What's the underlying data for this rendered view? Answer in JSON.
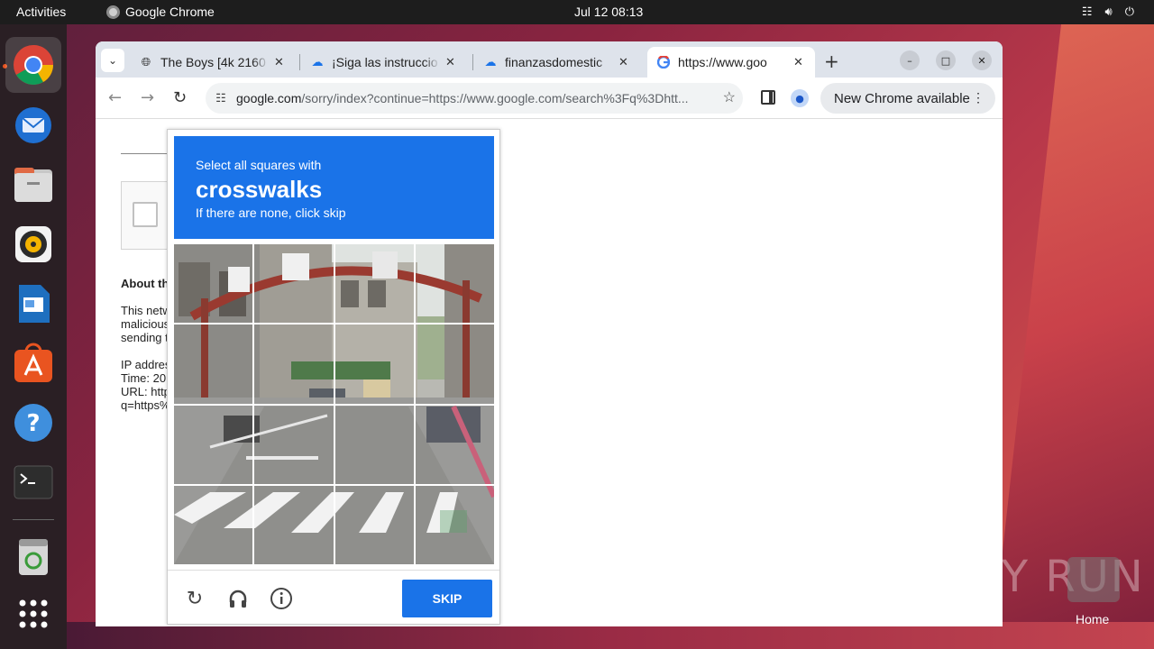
{
  "topbar": {
    "activities": "Activities",
    "app_name": "Google Chrome",
    "clock": "Jul 12  08:13",
    "tray": [
      "network-icon",
      "volume-icon",
      "power-icon"
    ]
  },
  "dock": {
    "items": [
      "chrome",
      "thunderbird",
      "files",
      "rhythmbox",
      "libreoffice-writer",
      "app-center",
      "help",
      "terminal",
      "trash",
      "show-apps"
    ]
  },
  "browser": {
    "tabs": [
      {
        "title": "The Boys [4k 2160",
        "icon": "globe-icon"
      },
      {
        "title": "¡Siga las instruccio",
        "icon": "download-icon"
      },
      {
        "title": "finanzasdomestic",
        "icon": "download-icon"
      },
      {
        "title": "https://www.goo",
        "icon": "google-icon",
        "active": true
      }
    ],
    "url_domain": "google.com",
    "url_rest": "/sorry/index?continue=https://www.google.com/search%3Fq%3Dhtt...",
    "update_label": "New Chrome available"
  },
  "page": {
    "about": "About th",
    "para1": [
      "This netw",
      "malicious",
      "sending t"
    ],
    "para2": [
      "IP addres",
      "Time: 20",
      "URL: http",
      "q=https%"
    ]
  },
  "captcha": {
    "line1": "Select all squares with",
    "keyword": "crosswalks",
    "line3": "If there are none, click skip",
    "skip_label": "SKIP",
    "grid_size": 4
  },
  "watermark": {
    "text": "ANY RUN",
    "home_label": "Home"
  }
}
